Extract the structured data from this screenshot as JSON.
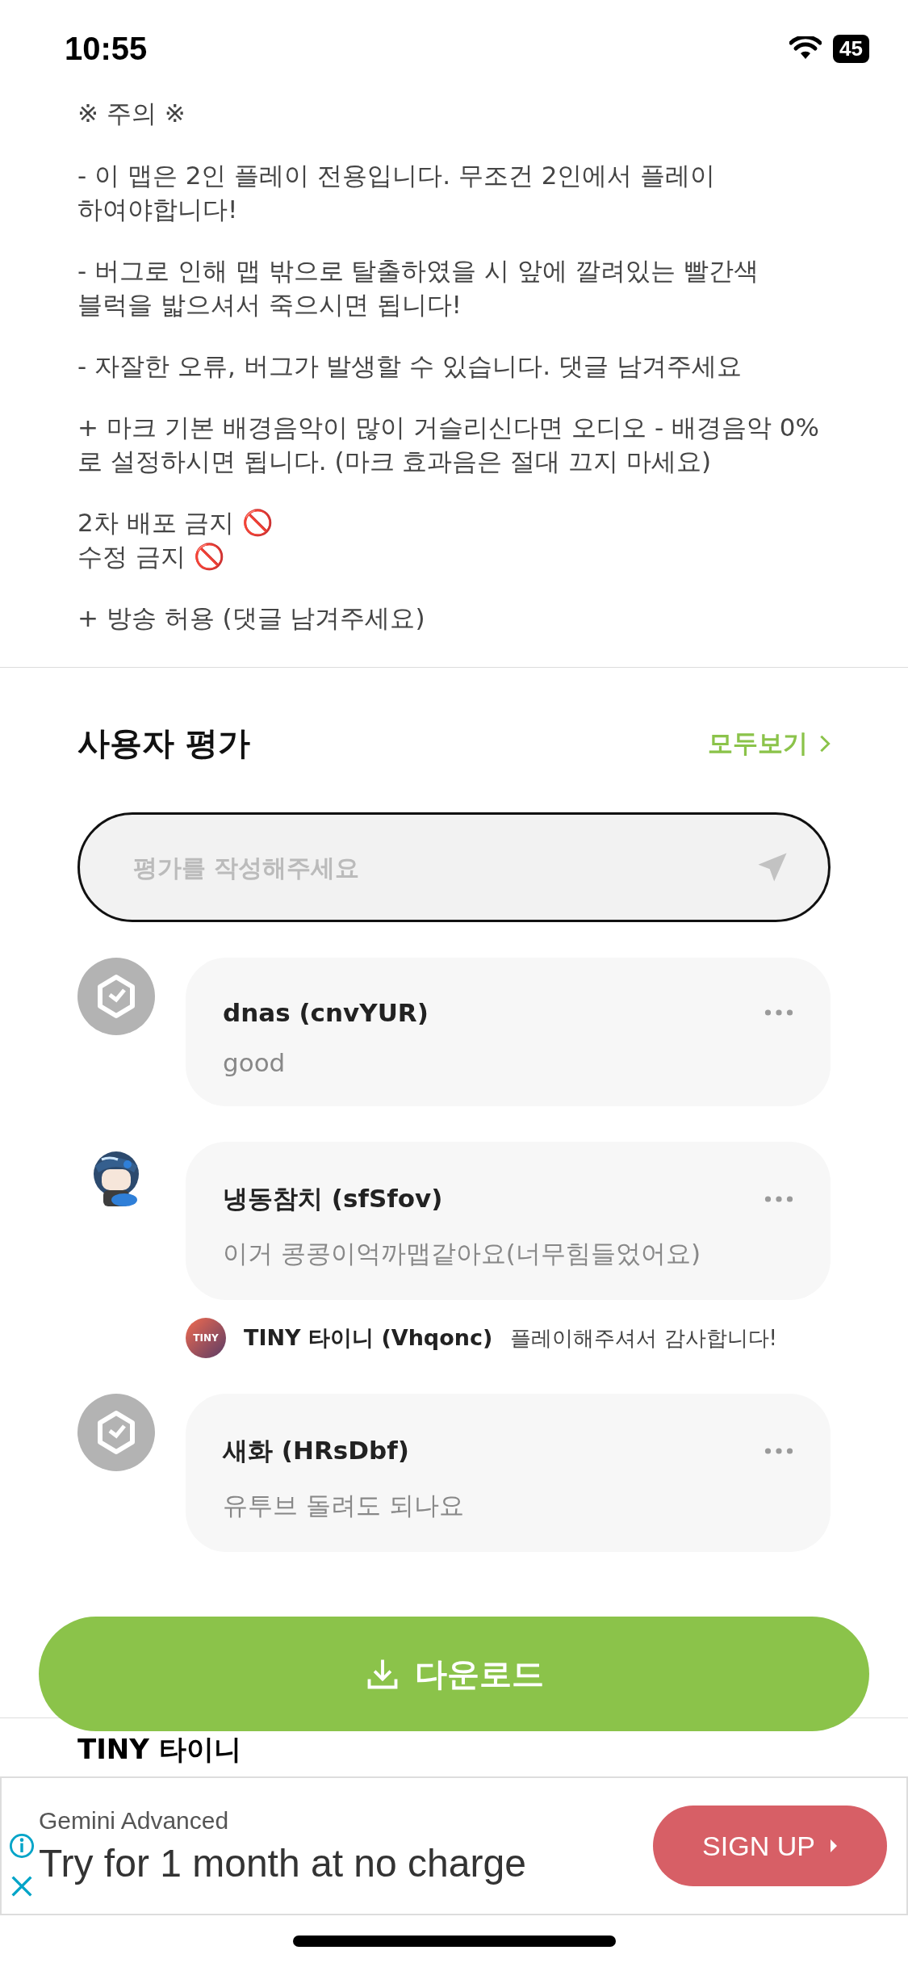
{
  "status_bar": {
    "time": "10:55",
    "battery": "45"
  },
  "notice": {
    "title": "※ 주의 ※",
    "paragraphs": [
      "- 이 맵은 2인 플레이 전용입니다. 무조건 2인에서 플레이 하여야합니다!",
      "- 버그로 인해 맵 밖으로 탈출하였을 시 앞에 깔려있는 빨간색 블럭을 밟으셔서 죽으시면 됩니다!",
      "- 자잘한 오류, 버그가 발생할 수 있습니다. 댓글 남겨주세요",
      "+ 마크 기본 배경음악이 많이 거슬리신다면 오디오 - 배경음악 0%로 설정하시면 됩니다. (마크 효과음은 절대 끄지 마세요)",
      "2차 배포 금지 🚫\n수정 금지 🚫",
      "+ 방송 허용 (댓글 남겨주세요)"
    ]
  },
  "reviews_section": {
    "title": "사용자 평가",
    "see_all": "모두보기",
    "input": {
      "placeholder": "평가를 작성해주세요"
    },
    "reviews": [
      {
        "kind": "default",
        "name": "dnas (cnvYUR)",
        "text": "good"
      },
      {
        "kind": "character",
        "name": "냉동참치 (sfSfov)",
        "text": "이거 콩콩이억까맵같아요(너무힘들었어요)",
        "replies": [
          {
            "avatar_label": "TINY",
            "name": "TINY 타이니 (Vhqonc)",
            "text": "플레이해주셔서 감사합니다!"
          }
        ]
      },
      {
        "kind": "default",
        "name": "새화 (HRsDbf)",
        "text": "유투브 돌려도 되나요"
      }
    ]
  },
  "download_button": {
    "label": "다운로드"
  },
  "next_section": {
    "title": "TINY 타이니"
  },
  "ad": {
    "brand": "Gemini Advanced",
    "headline": "Try for 1 month at no charge",
    "cta": "SIGN UP"
  }
}
